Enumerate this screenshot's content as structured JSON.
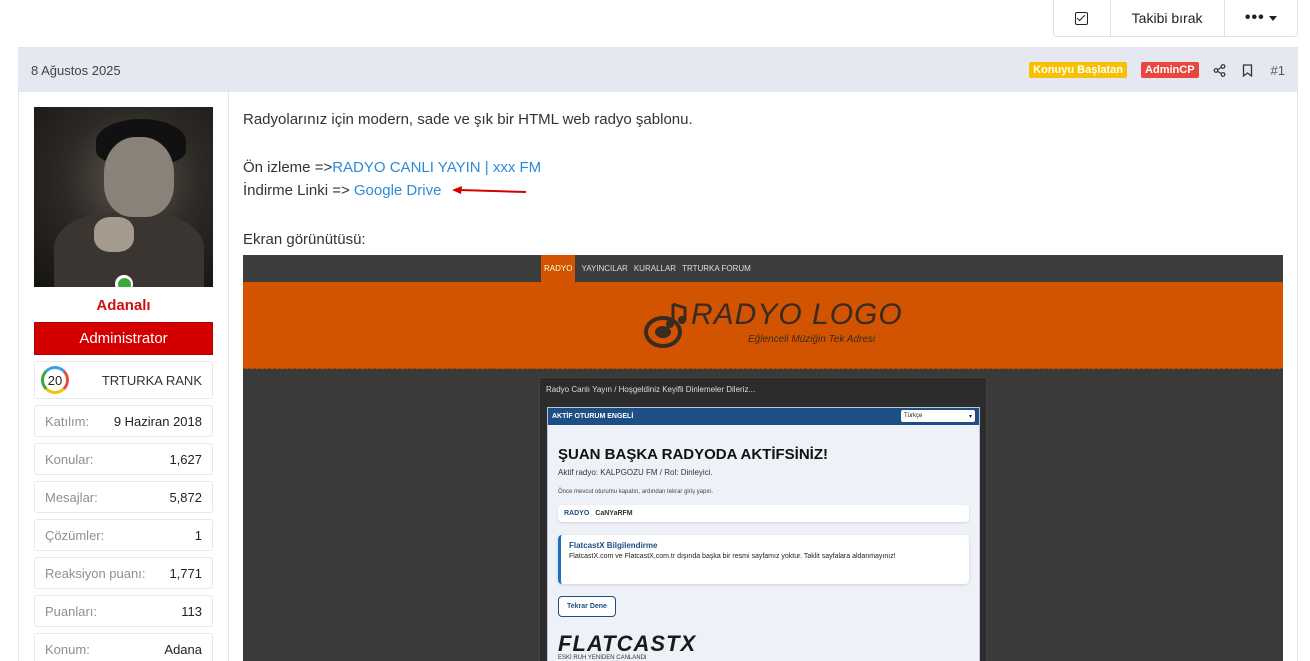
{
  "topbar": {
    "follow_label": "Takibi bırak",
    "more_label": "•••"
  },
  "post": {
    "date": "8 Ağustos 2025",
    "badge_starter": "Konuyu Başlatan",
    "badge_admin": "AdminCP",
    "number": "#1"
  },
  "user": {
    "name": "Adanalı",
    "role": "Administrator",
    "rank_level": "20",
    "rank_name": "TRTURKA RANK",
    "stats": [
      {
        "key": "Katılım:",
        "value": "9 Haziran 2018"
      },
      {
        "key": "Konular:",
        "value": "1,627"
      },
      {
        "key": "Mesajlar:",
        "value": "5,872"
      },
      {
        "key": "Çözümler:",
        "value": "1"
      },
      {
        "key": "Reaksiyon puanı:",
        "value": "1,771"
      },
      {
        "key": "Puanları:",
        "value": "113"
      },
      {
        "key": "Konum:",
        "value": "Adana"
      }
    ]
  },
  "content": {
    "intro": "Radyolarınız için modern, sade ve şık bir HTML web radyo şablonu.",
    "preview_prefix": "Ön izleme =>",
    "preview_link": "RADYO CANLI YAYIN | xxx FM",
    "download_prefix": "İndirme Linki => ",
    "download_link": "Google Drive",
    "screenshot_label": "Ekran görünütüsü:"
  },
  "screenshot": {
    "nav": [
      "RADYO",
      "YAYINCILAR",
      "KURALLAR",
      "TRTURKA FORUM"
    ],
    "logo_text": "RADYO LOGO",
    "logo_sub": "Eğlenceli Müziğin Tek Adresi",
    "main_title": "Radyo Canlı Yayın / Hoşgeldiniz Keyifli Dinlemeler Dileriz...",
    "modal_title": "AKTİF OTURUM ENGELİ",
    "lang_select": "Türkçe",
    "heading": "ŞUAN BAŞKA RADYODA AKTİFSİNİZ!",
    "active_line": "Aktif radyo: KALPGOZU FM / Rol: Dinleyici.",
    "small_line": "Önce mevcut oturumu kapatın, ardından tekrar giriş yapın.",
    "radio_label": "RADYO",
    "radio_value": "CaNYaRFM",
    "info_title": "FlatcastX Bilgilendirme",
    "info_text": "FlatcastX.com ve FlatcastX.com.tr dışında başka bir resmi sayfamız yoktur. Taklit sayfalara aldanmayınız!",
    "retry_button": "Tekrar Dene",
    "brand": "FLATCASTX",
    "brand_sub": "ESKİ RUH YENİDEN CANLANDI"
  }
}
